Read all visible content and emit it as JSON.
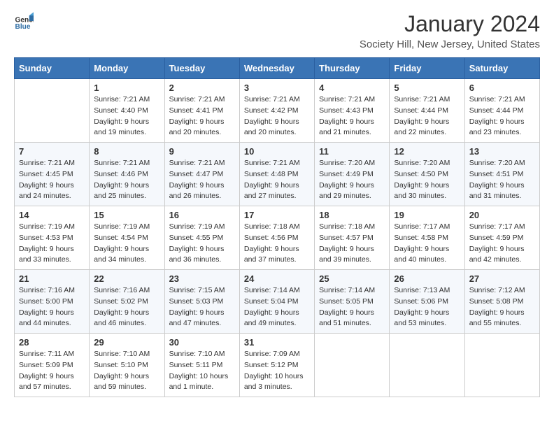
{
  "logo": {
    "text_general": "General",
    "text_blue": "Blue"
  },
  "title": "January 2024",
  "location": "Society Hill, New Jersey, United States",
  "days_of_week": [
    "Sunday",
    "Monday",
    "Tuesday",
    "Wednesday",
    "Thursday",
    "Friday",
    "Saturday"
  ],
  "weeks": [
    [
      {
        "day": "",
        "sunrise": "",
        "sunset": "",
        "daylight": ""
      },
      {
        "day": "1",
        "sunrise": "Sunrise: 7:21 AM",
        "sunset": "Sunset: 4:40 PM",
        "daylight": "Daylight: 9 hours and 19 minutes."
      },
      {
        "day": "2",
        "sunrise": "Sunrise: 7:21 AM",
        "sunset": "Sunset: 4:41 PM",
        "daylight": "Daylight: 9 hours and 20 minutes."
      },
      {
        "day": "3",
        "sunrise": "Sunrise: 7:21 AM",
        "sunset": "Sunset: 4:42 PM",
        "daylight": "Daylight: 9 hours and 20 minutes."
      },
      {
        "day": "4",
        "sunrise": "Sunrise: 7:21 AM",
        "sunset": "Sunset: 4:43 PM",
        "daylight": "Daylight: 9 hours and 21 minutes."
      },
      {
        "day": "5",
        "sunrise": "Sunrise: 7:21 AM",
        "sunset": "Sunset: 4:44 PM",
        "daylight": "Daylight: 9 hours and 22 minutes."
      },
      {
        "day": "6",
        "sunrise": "Sunrise: 7:21 AM",
        "sunset": "Sunset: 4:44 PM",
        "daylight": "Daylight: 9 hours and 23 minutes."
      }
    ],
    [
      {
        "day": "7",
        "sunrise": "Sunrise: 7:21 AM",
        "sunset": "Sunset: 4:45 PM",
        "daylight": "Daylight: 9 hours and 24 minutes."
      },
      {
        "day": "8",
        "sunrise": "Sunrise: 7:21 AM",
        "sunset": "Sunset: 4:46 PM",
        "daylight": "Daylight: 9 hours and 25 minutes."
      },
      {
        "day": "9",
        "sunrise": "Sunrise: 7:21 AM",
        "sunset": "Sunset: 4:47 PM",
        "daylight": "Daylight: 9 hours and 26 minutes."
      },
      {
        "day": "10",
        "sunrise": "Sunrise: 7:21 AM",
        "sunset": "Sunset: 4:48 PM",
        "daylight": "Daylight: 9 hours and 27 minutes."
      },
      {
        "day": "11",
        "sunrise": "Sunrise: 7:20 AM",
        "sunset": "Sunset: 4:49 PM",
        "daylight": "Daylight: 9 hours and 29 minutes."
      },
      {
        "day": "12",
        "sunrise": "Sunrise: 7:20 AM",
        "sunset": "Sunset: 4:50 PM",
        "daylight": "Daylight: 9 hours and 30 minutes."
      },
      {
        "day": "13",
        "sunrise": "Sunrise: 7:20 AM",
        "sunset": "Sunset: 4:51 PM",
        "daylight": "Daylight: 9 hours and 31 minutes."
      }
    ],
    [
      {
        "day": "14",
        "sunrise": "Sunrise: 7:19 AM",
        "sunset": "Sunset: 4:53 PM",
        "daylight": "Daylight: 9 hours and 33 minutes."
      },
      {
        "day": "15",
        "sunrise": "Sunrise: 7:19 AM",
        "sunset": "Sunset: 4:54 PM",
        "daylight": "Daylight: 9 hours and 34 minutes."
      },
      {
        "day": "16",
        "sunrise": "Sunrise: 7:19 AM",
        "sunset": "Sunset: 4:55 PM",
        "daylight": "Daylight: 9 hours and 36 minutes."
      },
      {
        "day": "17",
        "sunrise": "Sunrise: 7:18 AM",
        "sunset": "Sunset: 4:56 PM",
        "daylight": "Daylight: 9 hours and 37 minutes."
      },
      {
        "day": "18",
        "sunrise": "Sunrise: 7:18 AM",
        "sunset": "Sunset: 4:57 PM",
        "daylight": "Daylight: 9 hours and 39 minutes."
      },
      {
        "day": "19",
        "sunrise": "Sunrise: 7:17 AM",
        "sunset": "Sunset: 4:58 PM",
        "daylight": "Daylight: 9 hours and 40 minutes."
      },
      {
        "day": "20",
        "sunrise": "Sunrise: 7:17 AM",
        "sunset": "Sunset: 4:59 PM",
        "daylight": "Daylight: 9 hours and 42 minutes."
      }
    ],
    [
      {
        "day": "21",
        "sunrise": "Sunrise: 7:16 AM",
        "sunset": "Sunset: 5:00 PM",
        "daylight": "Daylight: 9 hours and 44 minutes."
      },
      {
        "day": "22",
        "sunrise": "Sunrise: 7:16 AM",
        "sunset": "Sunset: 5:02 PM",
        "daylight": "Daylight: 9 hours and 46 minutes."
      },
      {
        "day": "23",
        "sunrise": "Sunrise: 7:15 AM",
        "sunset": "Sunset: 5:03 PM",
        "daylight": "Daylight: 9 hours and 47 minutes."
      },
      {
        "day": "24",
        "sunrise": "Sunrise: 7:14 AM",
        "sunset": "Sunset: 5:04 PM",
        "daylight": "Daylight: 9 hours and 49 minutes."
      },
      {
        "day": "25",
        "sunrise": "Sunrise: 7:14 AM",
        "sunset": "Sunset: 5:05 PM",
        "daylight": "Daylight: 9 hours and 51 minutes."
      },
      {
        "day": "26",
        "sunrise": "Sunrise: 7:13 AM",
        "sunset": "Sunset: 5:06 PM",
        "daylight": "Daylight: 9 hours and 53 minutes."
      },
      {
        "day": "27",
        "sunrise": "Sunrise: 7:12 AM",
        "sunset": "Sunset: 5:08 PM",
        "daylight": "Daylight: 9 hours and 55 minutes."
      }
    ],
    [
      {
        "day": "28",
        "sunrise": "Sunrise: 7:11 AM",
        "sunset": "Sunset: 5:09 PM",
        "daylight": "Daylight: 9 hours and 57 minutes."
      },
      {
        "day": "29",
        "sunrise": "Sunrise: 7:10 AM",
        "sunset": "Sunset: 5:10 PM",
        "daylight": "Daylight: 9 hours and 59 minutes."
      },
      {
        "day": "30",
        "sunrise": "Sunrise: 7:10 AM",
        "sunset": "Sunset: 5:11 PM",
        "daylight": "Daylight: 10 hours and 1 minute."
      },
      {
        "day": "31",
        "sunrise": "Sunrise: 7:09 AM",
        "sunset": "Sunset: 5:12 PM",
        "daylight": "Daylight: 10 hours and 3 minutes."
      },
      {
        "day": "",
        "sunrise": "",
        "sunset": "",
        "daylight": ""
      },
      {
        "day": "",
        "sunrise": "",
        "sunset": "",
        "daylight": ""
      },
      {
        "day": "",
        "sunrise": "",
        "sunset": "",
        "daylight": ""
      }
    ]
  ]
}
